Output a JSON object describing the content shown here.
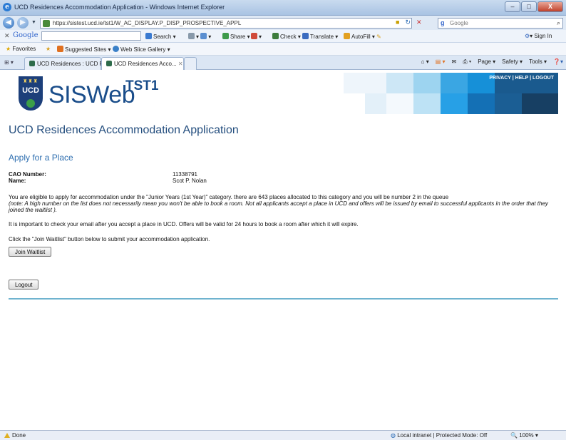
{
  "window": {
    "title": "UCD Residences Accommodation Application - Windows Internet Explorer",
    "min": "–",
    "max": "□",
    "close": "X"
  },
  "address": {
    "url": "https://sistest.ucd.ie/tst1/W_AC_DISPLAY.P_DISP_PROSPECTIVE_APPL",
    "search_placeholder": "Google"
  },
  "google_toolbar": {
    "logo": "Google",
    "search": "Search",
    "share": "Share",
    "check": "Check",
    "translate": "Translate",
    "autofill": "AutoFill",
    "signin": "Sign In"
  },
  "favorites": {
    "favorites": "Favorites",
    "suggested": "Suggested Sites",
    "webslice": "Web Slice Gallery"
  },
  "tabs": [
    {
      "label": "UCD Residences : UCD Res..."
    },
    {
      "label": "UCD Residences Acco..."
    }
  ],
  "commands": {
    "page": "Page",
    "safety": "Safety",
    "tools": "Tools"
  },
  "banner": {
    "crest_text": "UCD",
    "brand": "SISWeb",
    "env": "TST1",
    "links": "PRIVACY | HELP | LOGOUT"
  },
  "main": {
    "heading": "UCD Residences Accommodation Application",
    "subheading": "Apply for a Place",
    "cao_label": "CAO Number:",
    "cao_value": "11338791",
    "name_label": "Name:",
    "name_value": "Scot P. Nolan",
    "eligibility": "You are eligible to apply for accommodation under the \"Junior Years (1st Year)\" category. there are 643 places allocated to this category and you will be number 2 in the queue",
    "note": "(note: A high number on the list does not necessarily mean you won't be able to book a room. Not all applicants accept a place in UCD and offers will be issued by email to successful applicants in the order that they joined the waitlist ).",
    "email_notice": "It is important to check your email after you accept a place in UCD. Offers will be valid for 24 hours to book a room after which it will expire.",
    "instruction": "Click the \"Join Waitlist\" button below to submit your accommodation application.",
    "join_button": "Join Waitlist",
    "logout_button": "Logout"
  },
  "status": {
    "done": "Done",
    "zone": "Local intranet | Protected Mode: Off",
    "zoom": "100%"
  }
}
